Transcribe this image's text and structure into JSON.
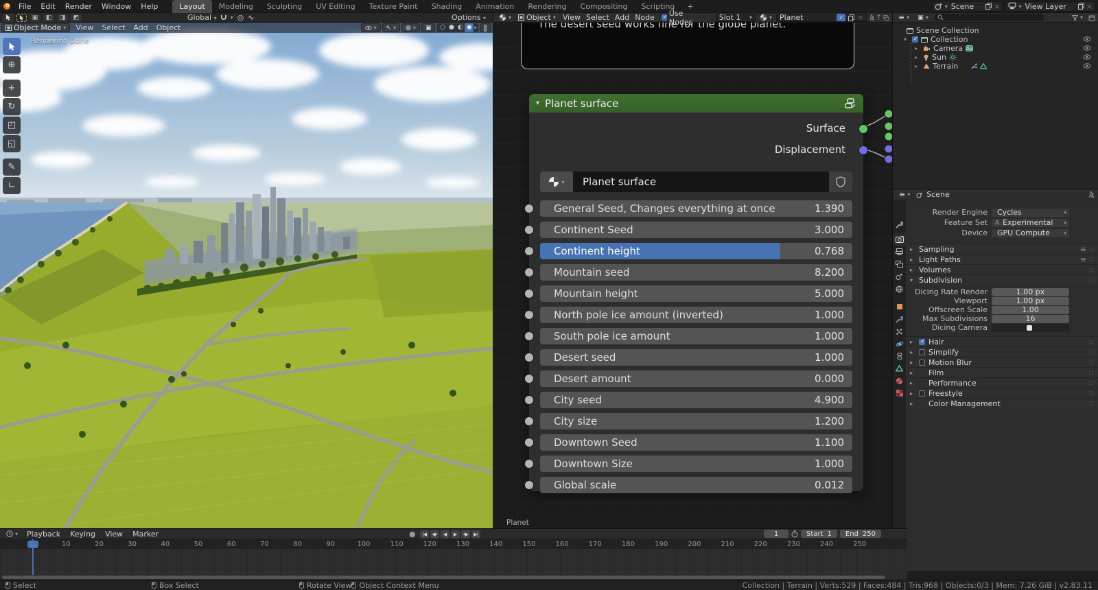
{
  "icons": {
    "chevron": "▾",
    "expand": "▸",
    "collapse": "▾",
    "check": "✓",
    "warning": "⚠",
    "plus": "+",
    "close": "×",
    "pause": "‖",
    "record": "●",
    "list": "≡",
    "grip": "∷",
    "up_arrow": "↑",
    "wire_circle": "○",
    "solid_circle": "●",
    "matpreview_circle": "◐",
    "rendered_circle": "◉",
    "prop_edit": "◎",
    "curve_falloff": "∿",
    "cursor_tool": "⊕",
    "move_tool": "+",
    "rotate_tool": "↻",
    "scale_tool": "◰",
    "transform_tool": "◱",
    "annotate_tool": "✎",
    "measure_tool": "∟"
  },
  "topbar": {
    "menus": [
      "File",
      "Edit",
      "Render",
      "Window",
      "Help"
    ],
    "workspaces": [
      {
        "label": "Layout",
        "active": true
      },
      {
        "label": "Modeling"
      },
      {
        "label": "Sculpting"
      },
      {
        "label": "UV Editing"
      },
      {
        "label": "Texture Paint"
      },
      {
        "label": "Shading"
      },
      {
        "label": "Animation"
      },
      {
        "label": "Rendering"
      },
      {
        "label": "Compositing"
      },
      {
        "label": "Scripting"
      }
    ],
    "new_workspace": "+",
    "scene": "Scene",
    "view_layer": "View Layer"
  },
  "tool_settings": {
    "orientation_label": "Global",
    "options_label": "Options"
  },
  "viewport": {
    "mode": "Object Mode",
    "menus": [
      "View",
      "Select",
      "Add",
      "Object"
    ],
    "status_overlay": "Rendering Done"
  },
  "node_editor": {
    "object_filter": "Object",
    "menus": [
      "View",
      "Select",
      "Add",
      "Node"
    ],
    "use_nodes_label": "Use Nodes",
    "slot": "Slot 1",
    "material_name": "Planet",
    "note_text": "The desert seed works fine for the globe planet.",
    "breadcrumb": "Planet",
    "node": {
      "title": "Planet surface",
      "group_name": "Planet surface",
      "outputs": [
        {
          "label": "Surface"
        },
        {
          "label": "Displacement"
        }
      ],
      "params": [
        {
          "label": "General Seed, Changes everything at once",
          "value": "1.390"
        },
        {
          "label": "Continent Seed",
          "value": "3.000"
        },
        {
          "label": "Continent height",
          "value": "0.768",
          "hl": true
        },
        {
          "label": "Mountain seed",
          "value": "8.200"
        },
        {
          "label": "Mountain height",
          "value": "5.000"
        },
        {
          "label": "North pole ice amount (inverted)",
          "value": "1.000"
        },
        {
          "label": "South pole ice amount",
          "value": "1.000"
        },
        {
          "label": "Desert seed",
          "value": "1.000"
        },
        {
          "label": "Desert amount",
          "value": "0.000"
        },
        {
          "label": "City seed",
          "value": "4.900"
        },
        {
          "label": "City size",
          "value": "1.200"
        },
        {
          "label": "Downtown Seed",
          "value": "1.100"
        },
        {
          "label": "Downtown Size",
          "value": "1.000"
        },
        {
          "label": "Global scale",
          "value": "0.012"
        }
      ]
    }
  },
  "outliner": {
    "rows": {
      "scene_collection": "Scene Collection",
      "collection": "Collection",
      "camera": "Camera",
      "sun": "Sun",
      "terrain": "Terrain"
    }
  },
  "properties": {
    "breadcrumb": "Scene",
    "render_fields": [
      {
        "label": "Render Engine",
        "value": "Cycles"
      },
      {
        "label": "Feature Set",
        "value": "Experimental",
        "icon": "⚠"
      },
      {
        "label": "Device",
        "value": "GPU Compute"
      }
    ],
    "top_panels": [
      {
        "label": "Sampling",
        "presets": true
      },
      {
        "label": "Light Paths",
        "presets": true
      },
      {
        "label": "Volumes"
      }
    ],
    "subdivision": {
      "label": "Subdivision",
      "rows": [
        {
          "label": "Dicing Rate Render",
          "value": "1.00 px"
        },
        {
          "label": "Viewport",
          "value": "1.00 px"
        },
        {
          "label": "Offscreen Scale",
          "value": "1.00"
        },
        {
          "label": "Max Subdivisions",
          "value": "16"
        },
        {
          "label": "Dicing Camera",
          "value": "",
          "object_field": true
        }
      ]
    },
    "bottom_panels": [
      {
        "label": "Hair",
        "checked": true
      },
      {
        "label": "Simplify"
      },
      {
        "label": "Motion Blur"
      },
      {
        "label": "Film",
        "noCb": true
      },
      {
        "label": "Performance",
        "noCb": true
      },
      {
        "label": "Freestyle"
      },
      {
        "label": "Color Management",
        "noCb": true
      }
    ]
  },
  "timeline": {
    "menus": [
      "Playback",
      "Keying",
      "View",
      "Marker"
    ],
    "playback": [
      {
        "name": "jump-to-start",
        "glyph": "|◀"
      },
      {
        "name": "prev-keyframe",
        "glyph": "◀•"
      },
      {
        "name": "play-reverse",
        "glyph": "◀"
      },
      {
        "name": "play",
        "glyph": "▶"
      },
      {
        "name": "next-keyframe",
        "glyph": "•▶"
      },
      {
        "name": "jump-to-end",
        "glyph": "▶|"
      }
    ],
    "ticks": [
      {
        "label": "1",
        "current": true
      },
      {
        "label": "10"
      },
      {
        "label": "20"
      },
      {
        "label": "30"
      },
      {
        "label": "40"
      },
      {
        "label": "50"
      },
      {
        "label": "60"
      },
      {
        "label": "70"
      },
      {
        "label": "80"
      },
      {
        "label": "90"
      },
      {
        "label": "100"
      },
      {
        "label": "110"
      },
      {
        "label": "120"
      },
      {
        "label": "130"
      },
      {
        "label": "140"
      },
      {
        "label": "150"
      },
      {
        "label": "160"
      },
      {
        "label": "170"
      },
      {
        "label": "180"
      },
      {
        "label": "190"
      },
      {
        "label": "200"
      },
      {
        "label": "210"
      },
      {
        "label": "220"
      },
      {
        "label": "230"
      },
      {
        "label": "240"
      },
      {
        "label": "250"
      }
    ],
    "current_frame": "1",
    "start_label": "Start",
    "start_value": "1",
    "end_label": "End",
    "end_value": "250"
  },
  "statusbar": {
    "hints": [
      {
        "label": "Select"
      },
      {
        "label": "Box Select"
      },
      {
        "label": "Rotate View"
      },
      {
        "label": "Object Context Menu"
      }
    ],
    "stats": "Collection | Terrain | Verts:529 | Faces:484 | Tris:968 | Objects:0/3 | Mem: 7.26 GiB | v2.83.11"
  },
  "colors": {
    "accent": "#4772b3",
    "node_header_green": "#3d6a2c",
    "socket_shader": "#63c763",
    "socket_vector": "#6e6ee0",
    "field_gray": "#545454"
  }
}
